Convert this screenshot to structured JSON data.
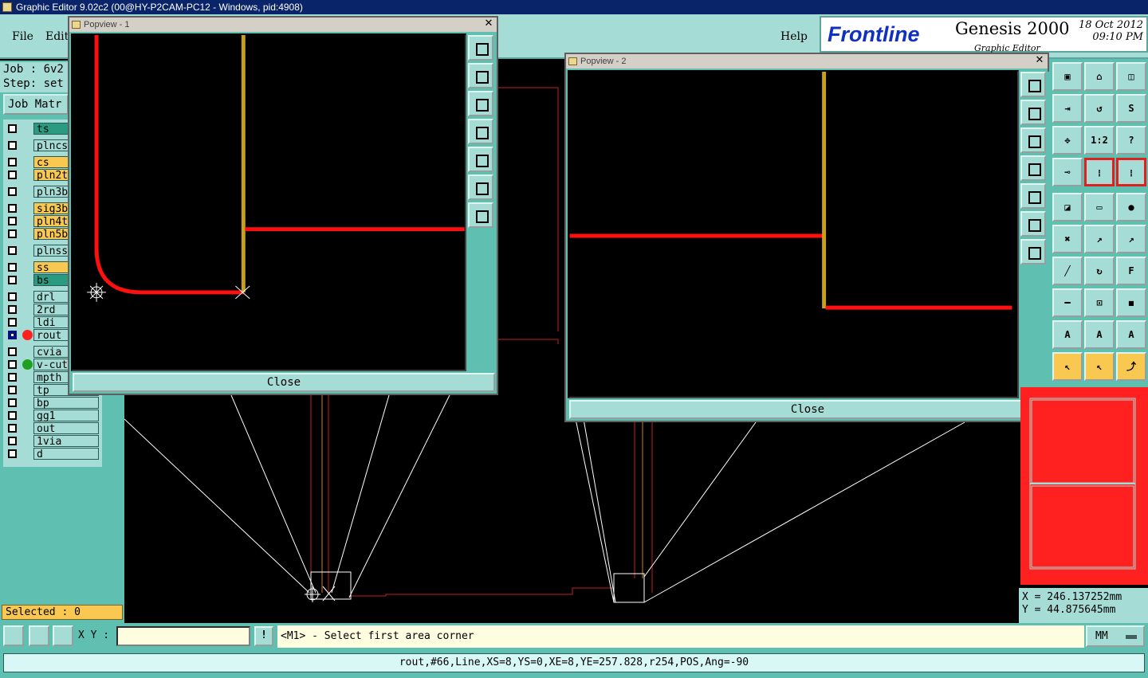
{
  "window": {
    "title": "Graphic Editor 9.02c2 (00@HY-P2CAM-PC12 - Windows, pid:4908)"
  },
  "menu": {
    "file": "File",
    "edit": "Edit",
    "help": "Help"
  },
  "logo": {
    "brand": "Frontline",
    "product": "Genesis 2000",
    "subtitle": "Graphic Editor",
    "date": "18 Oct 2012",
    "time": "09:10 PM"
  },
  "job": {
    "job_line": "Job : 6v2",
    "step_line": "Step: set",
    "matrix_label": "Job Matr"
  },
  "layers": [
    {
      "name": "ts",
      "color": "#2a9a80"
    },
    {
      "name": "plncs",
      "color": "#a6dcd6"
    },
    {
      "name": "cs",
      "color": "#f8c850"
    },
    {
      "name": "pln2t",
      "color": "#f8c850"
    },
    {
      "name": "pln3b",
      "color": "#a6dcd6"
    },
    {
      "name": "sig3b",
      "color": "#f8c850"
    },
    {
      "name": "pln4t",
      "color": "#f8c850"
    },
    {
      "name": "pln5b",
      "color": "#f8c850"
    },
    {
      "name": "plnss",
      "color": "#a6dcd6"
    },
    {
      "name": "ss",
      "color": "#f8c850"
    },
    {
      "name": "bs",
      "color": "#2a9a80"
    },
    {
      "name": "drl",
      "color": "#a6dcd6"
    },
    {
      "name": "2rd",
      "color": "#a6dcd6"
    },
    {
      "name": "ldi",
      "color": "#a6dcd6"
    },
    {
      "name": "rout",
      "color": "#a6dcd6",
      "selected": true,
      "dot": "#ff2020"
    },
    {
      "name": "cvia",
      "color": "#a6dcd6"
    },
    {
      "name": "v-cut",
      "color": "#a6dcd6",
      "dot": "#20a020"
    },
    {
      "name": "mpth",
      "color": "#a6dcd6"
    },
    {
      "name": "tp",
      "color": "#a6dcd6"
    },
    {
      "name": "bp",
      "color": "#a6dcd6"
    },
    {
      "name": "gg1",
      "color": "#a6dcd6"
    },
    {
      "name": "out",
      "color": "#a6dcd6"
    },
    {
      "name": "1via",
      "color": "#a6dcd6"
    },
    {
      "name": "d",
      "color": "#a6dcd6"
    }
  ],
  "selected": "Selected : 0",
  "popview1": {
    "title": "Popview - 1",
    "close": "Close"
  },
  "popview2": {
    "title": "Popview - 2",
    "close": "Close"
  },
  "coords": {
    "x": "X  = 246.137252mm",
    "y": "Y  = 44.875645mm"
  },
  "bottom": {
    "xy_label": "X Y :",
    "xy_value": "",
    "warn": "!",
    "prompt": "<M1> - Select first area corner",
    "units": "MM"
  },
  "status": "rout,#66,Line,XS=8,YS=0,XE=8,YE=257.828,r254,POS,Ang=-90",
  "toolbox_labels": {
    "ratio": "1:2",
    "help": "?"
  }
}
